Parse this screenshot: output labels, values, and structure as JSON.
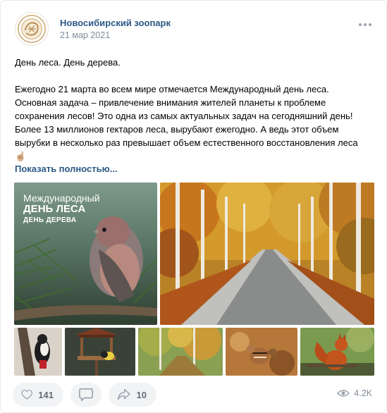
{
  "post": {
    "author": "Новосибирский зоопарк",
    "date": "21 мар 2021",
    "text_line_1": "День леса. День дерева.",
    "paragraph": [
      "Ежегодно 21 марта во всем мире отмечается Международный день леса.",
      "Основная задача – привлечение внимания жителей планеты к проблеме",
      "сохранения лесов! Это одна из самых актуальных задач на сегодняшний день!",
      "Более 13 миллионов гектаров леса, вырубают ежегодно. А ведь этот объем",
      "вырубки в несколько раз превышает объем естественного восстановления леса"
    ],
    "emoji": "☝🏼",
    "show_more": "Показать полностью..."
  },
  "photo_overlay": {
    "line1": "Международный",
    "line2": "ДЕНЬ ЛЕСА",
    "line3": "ДЕНЬ ДЕРЕВА"
  },
  "actions": {
    "likes": "141",
    "shares": "10",
    "views": "4.2K"
  },
  "icons": {
    "more": "more-dots-icon",
    "like": "heart-icon",
    "comment": "comment-icon",
    "share": "share-arrow-icon",
    "views": "eye-icon"
  },
  "colors": {
    "link": "#2a5885",
    "secondary": "#818c99",
    "button_bg": "#f2f3f5",
    "icon": "#99a2ad"
  }
}
